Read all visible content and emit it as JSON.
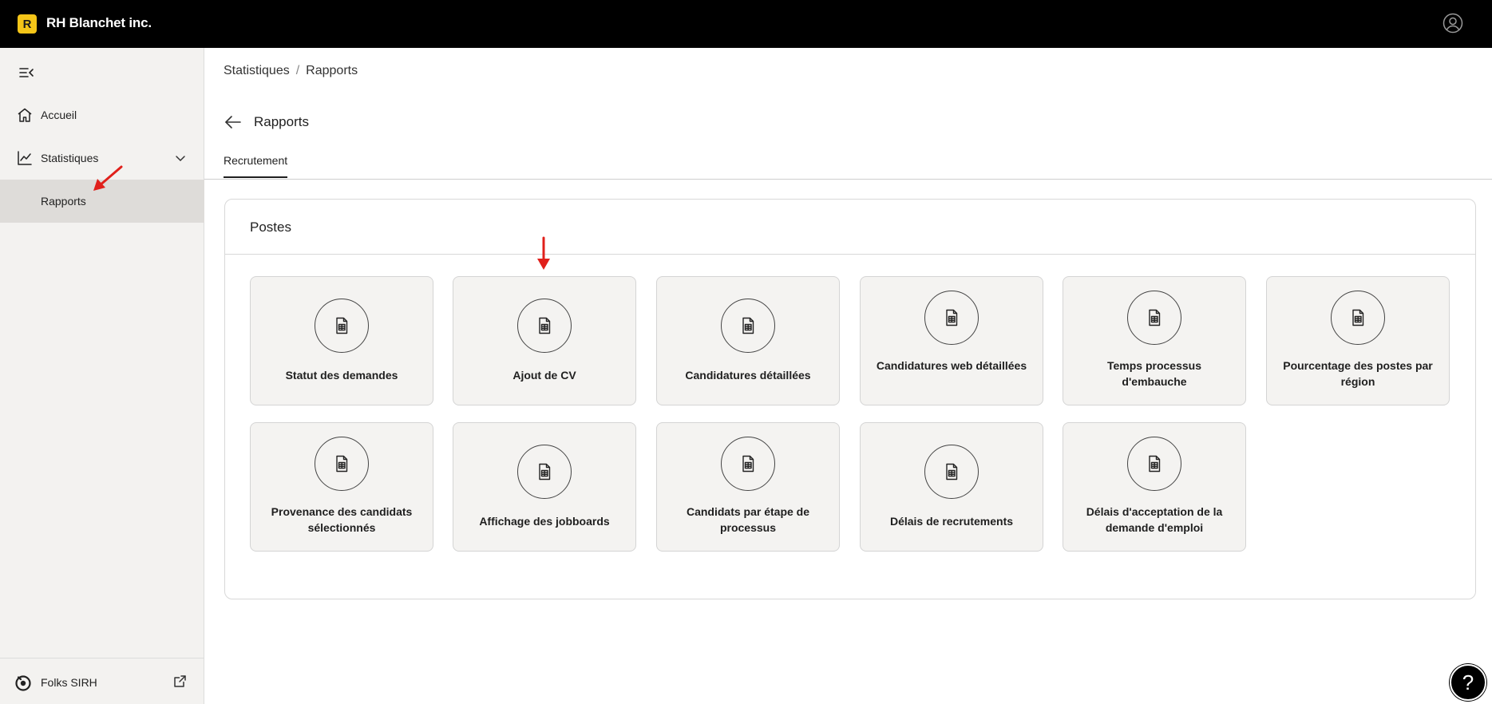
{
  "header": {
    "logo_letter": "R",
    "company_name": "RH Blanchet inc.",
    "icons": {
      "user": "user-circle-icon"
    }
  },
  "sidebar": {
    "collapse_icon": "collapse-menu-icon",
    "items": [
      {
        "label": "Accueil",
        "icon": "home-icon"
      },
      {
        "label": "Statistiques",
        "icon": "chart-line-icon",
        "expanded": true
      },
      {
        "label": "Rapports",
        "active": true
      }
    ],
    "footer": {
      "label": "Folks SIRH",
      "icon": "folks-logo-icon",
      "link_icon": "external-link-icon"
    }
  },
  "main": {
    "breadcrumb": [
      "Statistiques",
      "/",
      "Rapports"
    ],
    "title": "Rapports",
    "tabs": [
      {
        "label": "Recrutement",
        "active": true
      }
    ],
    "section": {
      "title": "Postes",
      "reports": [
        "Statut des demandes",
        "Ajout de CV",
        "Candidatures détaillées",
        "Candidatures web détaillées",
        "Temps processus d'embauche",
        "Pourcentage des postes par région",
        "Provenance des candidats sélectionnés",
        "Affichage des jobboards",
        "Candidats par étape de processus",
        "Délais de recrutements",
        "Délais d'acceptation de la demande d'emploi"
      ]
    }
  },
  "help": {
    "label": "?"
  },
  "colors": {
    "topbar": "#000000",
    "logo": "#f5c518",
    "sidebar": "#f3f2f0",
    "active_item": "#dedcd9",
    "card": "#f4f3f1",
    "annotation_arrow": "#e0201b"
  }
}
